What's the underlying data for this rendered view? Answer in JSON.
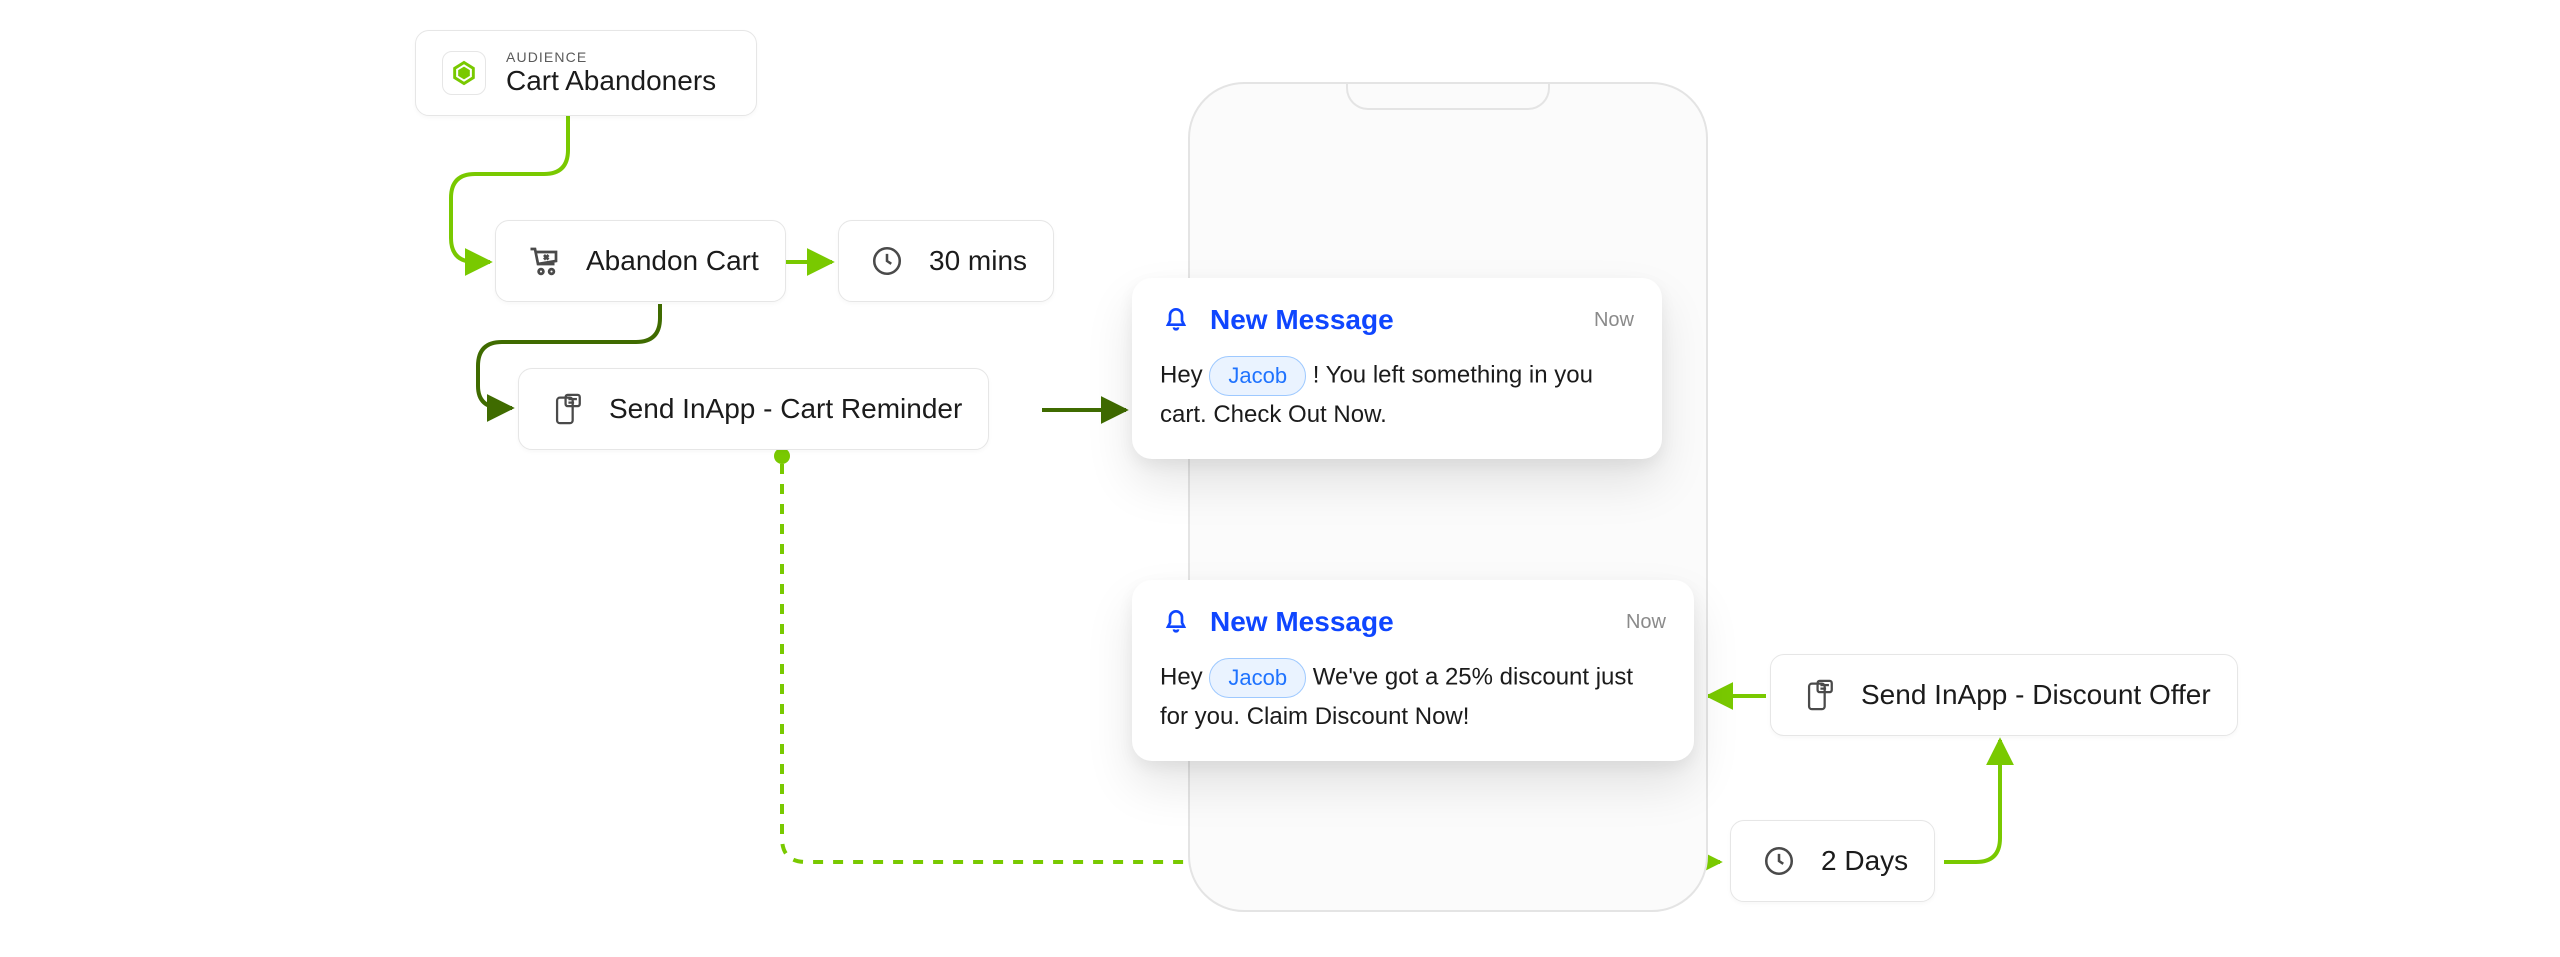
{
  "audience": {
    "eyebrow": "AUDIENCE",
    "name": "Cart Abandoners"
  },
  "event": {
    "label": "Abandon Cart"
  },
  "delay1": {
    "label": "30 mins"
  },
  "action1": {
    "label": "Send InApp  - Cart Reminder"
  },
  "delay2": {
    "label": "2 Days"
  },
  "action2": {
    "label": "Send InApp - Discount Offer"
  },
  "notif1": {
    "title": "New Message",
    "time": "Now",
    "body_pre": "Hey ",
    "chip": "Jacob",
    "body_post": " ! You left something in you cart. Check Out Now."
  },
  "notif2": {
    "title": "New Message",
    "time": "Now",
    "body_pre": "Hey ",
    "chip": "Jacob",
    "body_post": " We've got a 25% discount just for you. Claim Discount Now!"
  },
  "colors": {
    "connectorSolid": "#3f6b00",
    "connectorDash": "#79c900",
    "accentBlue": "#0f46ff"
  }
}
